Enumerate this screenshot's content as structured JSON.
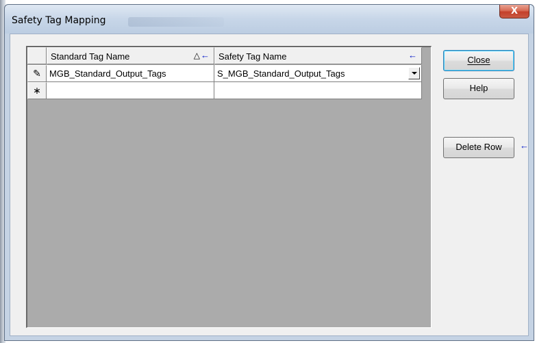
{
  "window": {
    "title": "Safety Tag Mapping",
    "close_label": "X"
  },
  "grid": {
    "columns": [
      {
        "label": "Standard Tag Name",
        "sort_glyph": "△",
        "arrow_glyph": "←"
      },
      {
        "label": "Safety Tag Name",
        "arrow_glyph": "←"
      }
    ],
    "rows": [
      {
        "indicator": "✎",
        "standard_tag": "MGB_Standard_Output_Tags",
        "safety_tag": "S_MGB_Standard_Output_Tags"
      },
      {
        "indicator": "∗",
        "standard_tag": "",
        "safety_tag": ""
      }
    ]
  },
  "buttons": {
    "close": "Close",
    "help": "Help",
    "delete_row": "Delete Row",
    "delete_row_arrow": "←"
  },
  "colors": {
    "arrow_blue": "#0015c8",
    "grid_background": "#ababab",
    "dialog_background": "#f0f0f0"
  }
}
